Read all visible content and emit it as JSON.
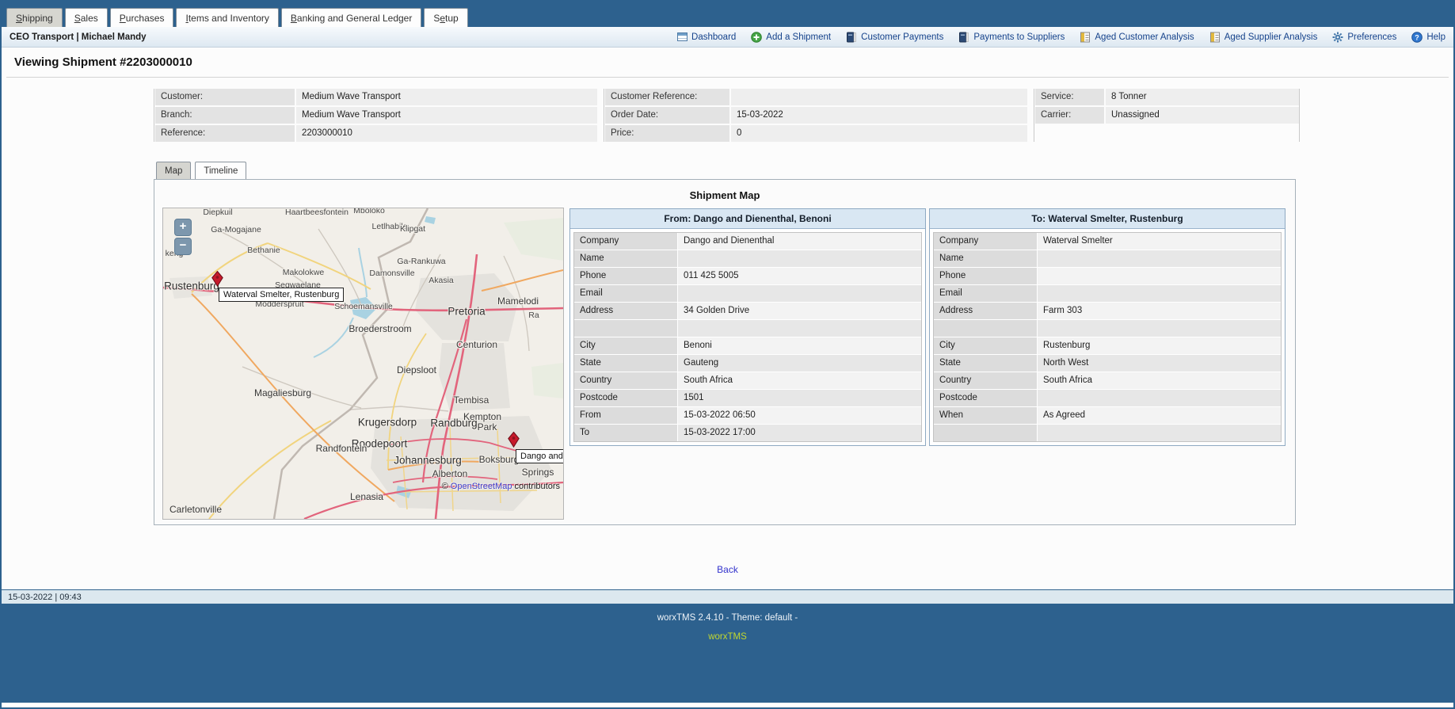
{
  "window": {
    "tabs": [
      {
        "pre": "",
        "key": "S",
        "post": "hipping"
      },
      {
        "pre": "",
        "key": "S",
        "post": "ales"
      },
      {
        "pre": "",
        "key": "P",
        "post": "urchases"
      },
      {
        "pre": "",
        "key": "I",
        "post": "tems and Inventory"
      },
      {
        "pre": "",
        "key": "B",
        "post": "anking and General Ledger"
      },
      {
        "pre": "S",
        "key": "e",
        "post": "tup"
      }
    ],
    "user_bar": "CEO Transport | Michael Mandy",
    "toolbar": [
      {
        "icon": "dashboard-icon",
        "label": "Dashboard"
      },
      {
        "icon": "add-icon",
        "label": "Add a Shipment"
      },
      {
        "icon": "ledger-icon",
        "label": "Customer Payments"
      },
      {
        "icon": "ledger-icon",
        "label": "Payments to Suppliers"
      },
      {
        "icon": "report-icon",
        "label": "Aged Customer Analysis"
      },
      {
        "icon": "report-icon",
        "label": "Aged Supplier Analysis"
      },
      {
        "icon": "gear-icon",
        "label": "Preferences"
      },
      {
        "icon": "help-icon",
        "label": "Help"
      }
    ]
  },
  "page": {
    "title": "Viewing Shipment #2203000010"
  },
  "summary": {
    "groups": [
      {
        "rows": [
          {
            "label": "Customer:",
            "value": "Medium Wave Transport"
          },
          {
            "label": "Branch:",
            "value": "Medium Wave Transport"
          },
          {
            "label": "Reference:",
            "value": "2203000010"
          }
        ]
      },
      {
        "rows": [
          {
            "label": "Customer Reference:",
            "value": ""
          },
          {
            "label": "Order Date:",
            "value": "15-03-2022"
          },
          {
            "label": "Price:",
            "value": "0"
          }
        ]
      },
      {
        "rows": [
          {
            "label": "Service:",
            "value": "8 Tonner"
          },
          {
            "label": "Carrier:",
            "value": "Unassigned"
          }
        ]
      }
    ]
  },
  "view_tabs": {
    "map": "Map",
    "timeline": "Timeline"
  },
  "map_panel": {
    "title": "Shipment Map"
  },
  "map": {
    "zoom_in": "+",
    "zoom_out": "−",
    "attribution": {
      "copyright": "©",
      "link": "OpenStreetMap",
      "suffix": "contributors"
    },
    "markers": [
      {
        "label": "Waterval Smelter, Rustenburg"
      },
      {
        "label": "Dango and"
      }
    ],
    "labels": [
      "Diepkuil",
      "Haartbeesfontein",
      "Mboloko",
      "Ga-Mogajane",
      "Letlhabile",
      "Klipgat",
      "Bethanie",
      "keng",
      "Ga-Rankuwa",
      "Makolokwe",
      "Damonsville",
      "Akasia",
      "Rustenburg",
      "Segwaelane",
      "Mamelodi",
      "Modderspruit",
      "Schoemansville",
      "Pretoria",
      "Ra",
      "Broederstroom",
      "Centurion",
      "Diepsloot",
      "Magaliesburg",
      "Tembisa",
      "Krugersdorp",
      "Randburg",
      "Kempton",
      "Park",
      "Roodepoort",
      "Randfontein",
      "Johannesburg",
      "Boksburg",
      "Alberton",
      "Springs",
      "Lenasia",
      "Carletonville"
    ]
  },
  "from_table": {
    "header": "From: Dango and Dienenthal, Benoni",
    "rows": [
      {
        "label": "Company",
        "value": "Dango and Dienenthal"
      },
      {
        "label": "Name",
        "value": ""
      },
      {
        "label": "Phone",
        "value": "011 425 5005"
      },
      {
        "label": "Email",
        "value": ""
      },
      {
        "label": "Address",
        "value": "34 Golden Drive"
      },
      {
        "label": "",
        "value": ""
      },
      {
        "label": "City",
        "value": "Benoni"
      },
      {
        "label": "State",
        "value": "Gauteng"
      },
      {
        "label": "Country",
        "value": "South Africa"
      },
      {
        "label": "Postcode",
        "value": "1501"
      },
      {
        "label": "From",
        "value": "15-03-2022 06:50"
      },
      {
        "label": "To",
        "value": "15-03-2022 17:00"
      }
    ]
  },
  "to_table": {
    "header": "To: Waterval Smelter, Rustenburg",
    "rows": [
      {
        "label": "Company",
        "value": "Waterval Smelter"
      },
      {
        "label": "Name",
        "value": ""
      },
      {
        "label": "Phone",
        "value": ""
      },
      {
        "label": "Email",
        "value": ""
      },
      {
        "label": "Address",
        "value": "Farm 303"
      },
      {
        "label": "",
        "value": ""
      },
      {
        "label": "City",
        "value": "Rustenburg"
      },
      {
        "label": "State",
        "value": "North West"
      },
      {
        "label": "Country",
        "value": "South Africa"
      },
      {
        "label": "Postcode",
        "value": ""
      },
      {
        "label": "When",
        "value": "As Agreed"
      },
      {
        "label": "",
        "value": ""
      }
    ]
  },
  "back_label": "Back",
  "status_bar": {
    "text": "15-03-2022 | 09:43"
  },
  "footer": {
    "version_line": "worxTMS 2.4.10 - Theme: default -",
    "brand_link": "worxTMS"
  },
  "colors": {
    "frame_blue": "#2d618e",
    "toolbar_link": "#15428b",
    "tab_active_bg": "#d6d6d0",
    "table_header_bg": "#d9e7f3",
    "marker_red": "#c61a2b",
    "brand_link_green": "#c2d82f"
  }
}
